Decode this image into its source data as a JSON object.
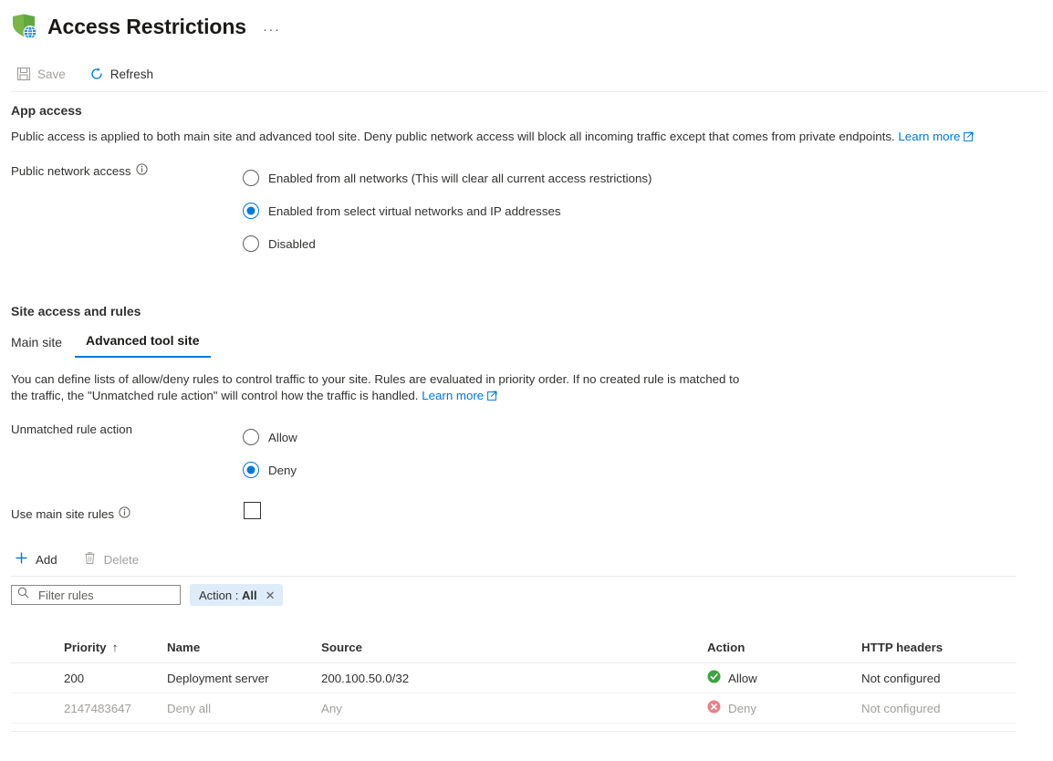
{
  "header": {
    "title": "Access Restrictions",
    "icon": "shield-globe-icon",
    "more_label": "···"
  },
  "commandbar": {
    "save_label": "Save",
    "save_enabled": false,
    "refresh_label": "Refresh",
    "refresh_enabled": true
  },
  "app_access": {
    "section_title": "App access",
    "description": "Public access is applied to both main site and advanced tool site. Deny public network access will block all incoming traffic except that comes from private endpoints.",
    "learn_more": "Learn more",
    "field_label": "Public network access",
    "options": [
      {
        "label": "Enabled from all networks (This will clear all current access restrictions)",
        "selected": false
      },
      {
        "label": "Enabled from select virtual networks and IP addresses",
        "selected": true
      },
      {
        "label": "Disabled",
        "selected": false
      }
    ]
  },
  "site_access": {
    "section_title": "Site access and rules",
    "tabs": [
      {
        "label": "Main site",
        "active": false
      },
      {
        "label": "Advanced tool site",
        "active": true
      }
    ],
    "description": "You can define lists of allow/deny rules to control traffic to your site. Rules are evaluated in priority order. If no created rule is matched to the traffic, the \"Unmatched rule action\" will control how the traffic is handled.",
    "learn_more": "Learn more",
    "unmatched_label": "Unmatched rule action",
    "unmatched_options": [
      {
        "label": "Allow",
        "selected": false
      },
      {
        "label": "Deny",
        "selected": true
      }
    ],
    "use_main_site_rules_label": "Use main site rules",
    "use_main_site_rules_checked": false
  },
  "table_toolbar": {
    "add_label": "Add",
    "add_enabled": true,
    "delete_label": "Delete",
    "delete_enabled": false,
    "filter_placeholder": "Filter rules",
    "filter_value": "",
    "pill_key": "Action : ",
    "pill_value": "All",
    "pill_close": "✕"
  },
  "rules_table": {
    "columns": [
      "Priority",
      "Name",
      "Source",
      "Action",
      "HTTP headers"
    ],
    "sort_column": "Priority",
    "sort_direction": "↑",
    "rows": [
      {
        "priority": "200",
        "name": "Deployment server",
        "source": "200.100.50.0/32",
        "action": "Allow",
        "action_type": "allow",
        "http_headers": "Not configured",
        "dimmed": false
      },
      {
        "priority": "2147483647",
        "name": "Deny all",
        "source": "Any",
        "action": "Deny",
        "action_type": "deny",
        "http_headers": "Not configured",
        "dimmed": true
      }
    ]
  },
  "colors": {
    "accent": "#0078d4",
    "allow_green": "#107c10",
    "deny_red": "#e8808a",
    "pill_bg": "#deecf9",
    "shield_green": "#5fa83d"
  }
}
